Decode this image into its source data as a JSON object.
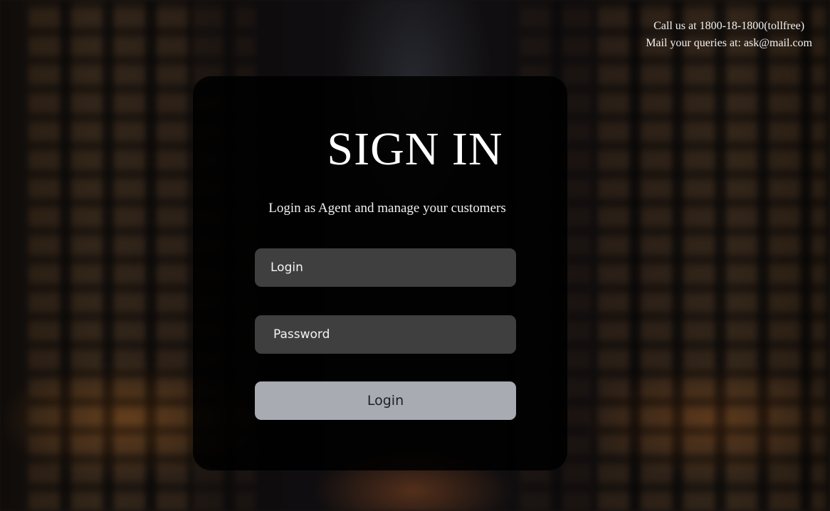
{
  "contact": {
    "phone_line": "Call us at 1800-18-1800(tollfree)",
    "mail_line": "Mail your queries at: ask@mail.com"
  },
  "signin": {
    "title": "SIGN IN",
    "subtitle": "Login as Agent and manage your customers",
    "login_placeholder": "Login",
    "password_placeholder": "Password",
    "submit_label": "Login"
  },
  "colors": {
    "card_background": "#000000",
    "field_background": "#3f3f3f",
    "button_background": "#a9abb2",
    "text_primary": "#ffffff"
  }
}
